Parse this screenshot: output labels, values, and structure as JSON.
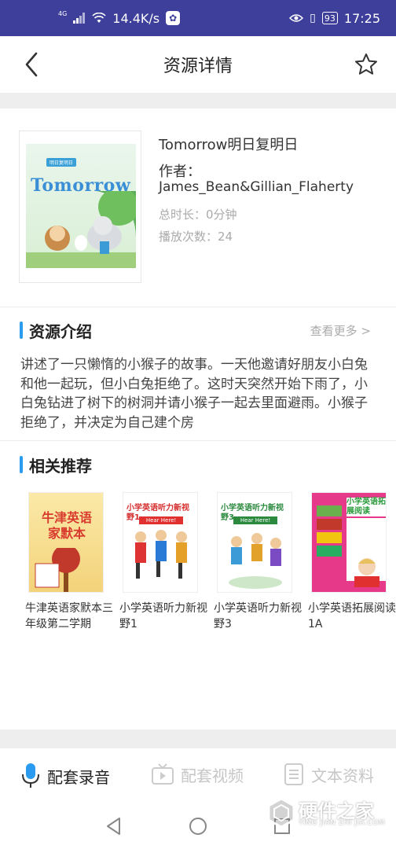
{
  "status_bar": {
    "network": "4G",
    "speed": "14.4K/s",
    "battery": "93",
    "time": "17:25"
  },
  "header": {
    "title": "资源详情"
  },
  "book": {
    "title": "Tomorrow明日复明日",
    "author_label": "作者：",
    "author": "James_Bean&Gillian_Flaherty",
    "duration": "总时长：0分钟",
    "plays": "播放次数：24",
    "cover_title": "Tomorrow"
  },
  "intro": {
    "heading": "资源介绍",
    "more": "查看更多 >",
    "text": "讲述了一只懒惰的小猴子的故事。一天他邀请好朋友小白兔和他一起玩，但小白兔拒绝了。这时天突然开始下雨了，小白兔钻进了树下的树洞并请小猴子一起去里面避雨。小猴子拒绝了，并决定为自己建个房"
  },
  "recommend": {
    "heading": "相关推荐",
    "items": [
      {
        "name": "牛津英语家默本三年级第二学期",
        "cover_text": "牛津英语家默本"
      },
      {
        "name": "小学英语听力新视野1",
        "cover_text": "小学英语听力新视野1"
      },
      {
        "name": "小学英语听力新视野3",
        "cover_text": "小学英语听力新视野3"
      },
      {
        "name": "小学英语拓展阅读1A",
        "cover_text": "小学英语拓展阅读"
      }
    ]
  },
  "tabs": [
    {
      "label": "配套录音",
      "active": true
    },
    {
      "label": "配套视频",
      "active": false
    },
    {
      "label": "文本资料",
      "active": false
    }
  ],
  "watermark": {
    "text": "硬件之家",
    "sub": "YING JIAN ZHI JIA.COM"
  },
  "colors": {
    "status_bar": "#3d3f9b",
    "accent": "#2a9bef",
    "muted": "#aaaaaa"
  }
}
